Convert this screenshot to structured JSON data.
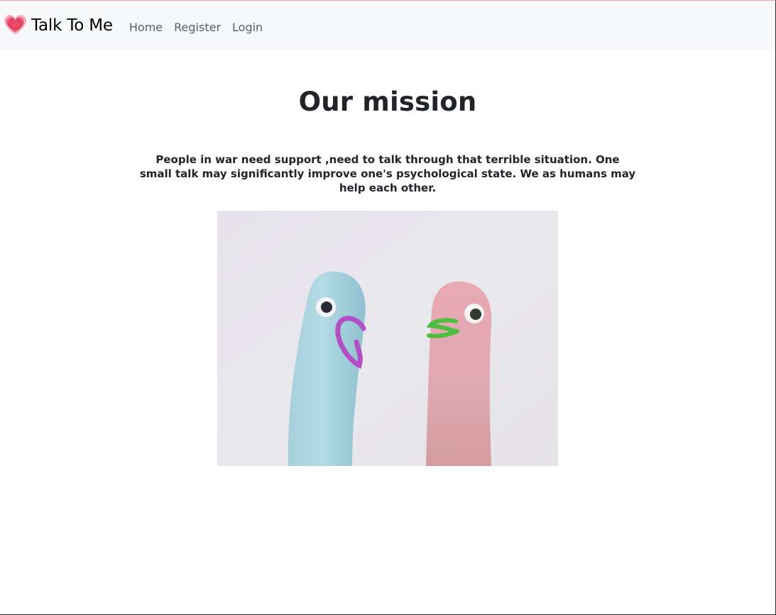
{
  "navbar": {
    "brand": "Talk To Me",
    "brand_icon": "heart-icon",
    "links": [
      {
        "label": "Home"
      },
      {
        "label": "Register"
      },
      {
        "label": "Login"
      }
    ]
  },
  "main": {
    "title": "Our mission",
    "description": "People in war need support ,need to talk through that terrible situation. One small talk may significantly improve one's psychological state. We as humans may help each other."
  },
  "colors": {
    "navbar_bg": "#f8f9fa",
    "heart": "#e83e5c",
    "text": "#212529",
    "nav_link": "#5c5f63"
  }
}
